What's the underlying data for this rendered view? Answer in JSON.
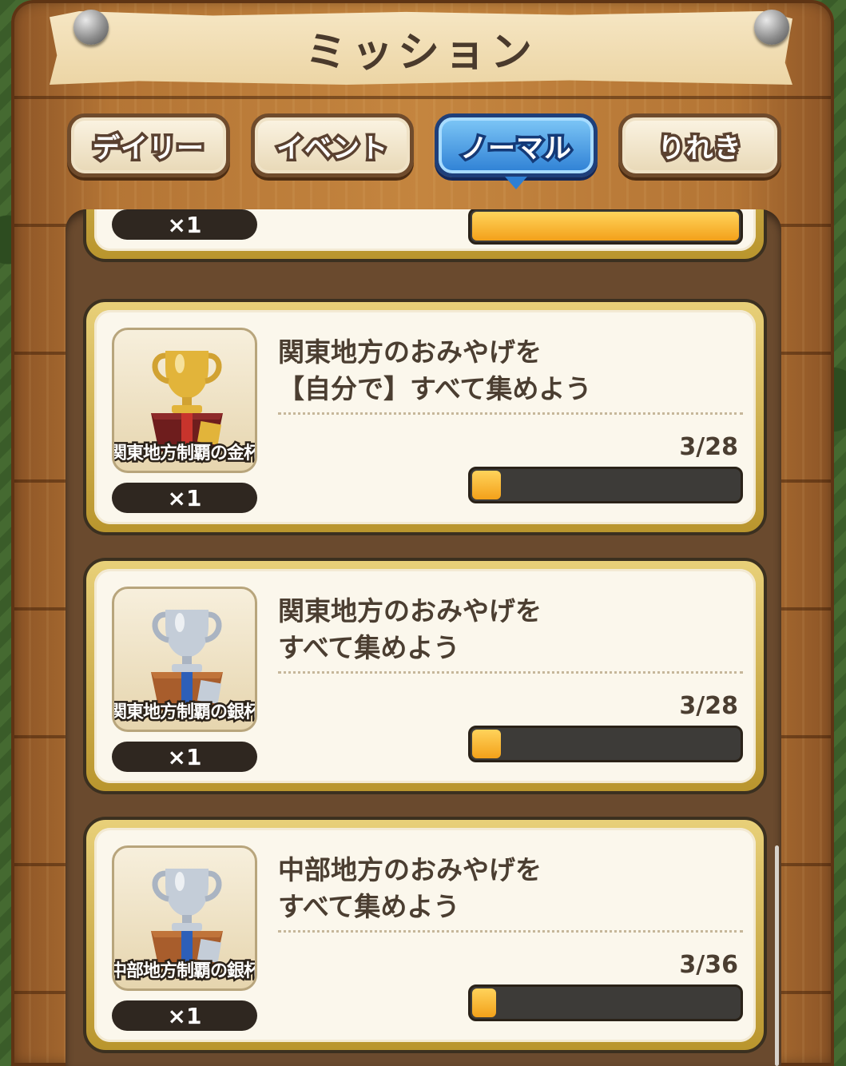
{
  "header": {
    "title": "ミッション"
  },
  "tabs": [
    {
      "label": "デイリー",
      "active": false
    },
    {
      "label": "イベント",
      "active": false
    },
    {
      "label": "ノーマル",
      "active": true
    },
    {
      "label": "りれき",
      "active": false
    }
  ],
  "missions": [
    {
      "reward_qty": "×1",
      "progress_fraction": 1.0
    },
    {
      "reward_name": "関東地方制覇の金杯",
      "reward_qty": "×1",
      "trophy": "gold-trophy",
      "text": "関東地方のおみやげを\n【自分で】すべて集めよう",
      "progress": "3/28",
      "progress_fraction": 0.107
    },
    {
      "reward_name": "関東地方制覇の銀杯",
      "reward_qty": "×1",
      "trophy": "silver-trophy",
      "text": "関東地方のおみやげを\nすべて集めよう",
      "progress": "3/28",
      "progress_fraction": 0.107
    },
    {
      "reward_name": "中部地方制覇の銀杯",
      "reward_qty": "×1",
      "trophy": "silver-trophy",
      "text": "中部地方のおみやげを\nすべて集めよう",
      "progress": "3/36",
      "progress_fraction": 0.083
    }
  ],
  "colors": {
    "gold": "#e2b43a",
    "silver": "#c4cdd8",
    "active_tab": "#2d7fd4",
    "progress_fill": "#f3a11a"
  }
}
